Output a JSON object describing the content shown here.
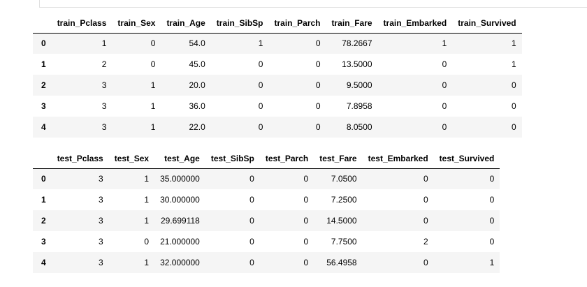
{
  "train": {
    "columns": [
      "train_Pclass",
      "train_Sex",
      "train_Age",
      "train_SibSp",
      "train_Parch",
      "train_Fare",
      "train_Embarked",
      "train_Survived"
    ],
    "rows": [
      {
        "index": "0",
        "cells": [
          "1",
          "0",
          "54.0",
          "1",
          "0",
          "78.2667",
          "1",
          "1"
        ]
      },
      {
        "index": "1",
        "cells": [
          "2",
          "0",
          "45.0",
          "0",
          "0",
          "13.5000",
          "0",
          "1"
        ]
      },
      {
        "index": "2",
        "cells": [
          "3",
          "1",
          "20.0",
          "0",
          "0",
          "9.5000",
          "0",
          "0"
        ]
      },
      {
        "index": "3",
        "cells": [
          "3",
          "1",
          "36.0",
          "0",
          "0",
          "7.8958",
          "0",
          "0"
        ]
      },
      {
        "index": "4",
        "cells": [
          "3",
          "1",
          "22.0",
          "0",
          "0",
          "8.0500",
          "0",
          "0"
        ]
      }
    ]
  },
  "test": {
    "columns": [
      "test_Pclass",
      "test_Sex",
      "test_Age",
      "test_SibSp",
      "test_Parch",
      "test_Fare",
      "test_Embarked",
      "test_Survived"
    ],
    "rows": [
      {
        "index": "0",
        "cells": [
          "3",
          "1",
          "35.000000",
          "0",
          "0",
          "7.0500",
          "0",
          "0"
        ]
      },
      {
        "index": "1",
        "cells": [
          "3",
          "1",
          "30.000000",
          "0",
          "0",
          "7.2500",
          "0",
          "0"
        ]
      },
      {
        "index": "2",
        "cells": [
          "3",
          "1",
          "29.699118",
          "0",
          "0",
          "14.5000",
          "0",
          "0"
        ]
      },
      {
        "index": "3",
        "cells": [
          "3",
          "0",
          "21.000000",
          "0",
          "0",
          "7.7500",
          "2",
          "0"
        ]
      },
      {
        "index": "4",
        "cells": [
          "3",
          "1",
          "32.000000",
          "0",
          "0",
          "56.4958",
          "0",
          "1"
        ]
      }
    ]
  }
}
